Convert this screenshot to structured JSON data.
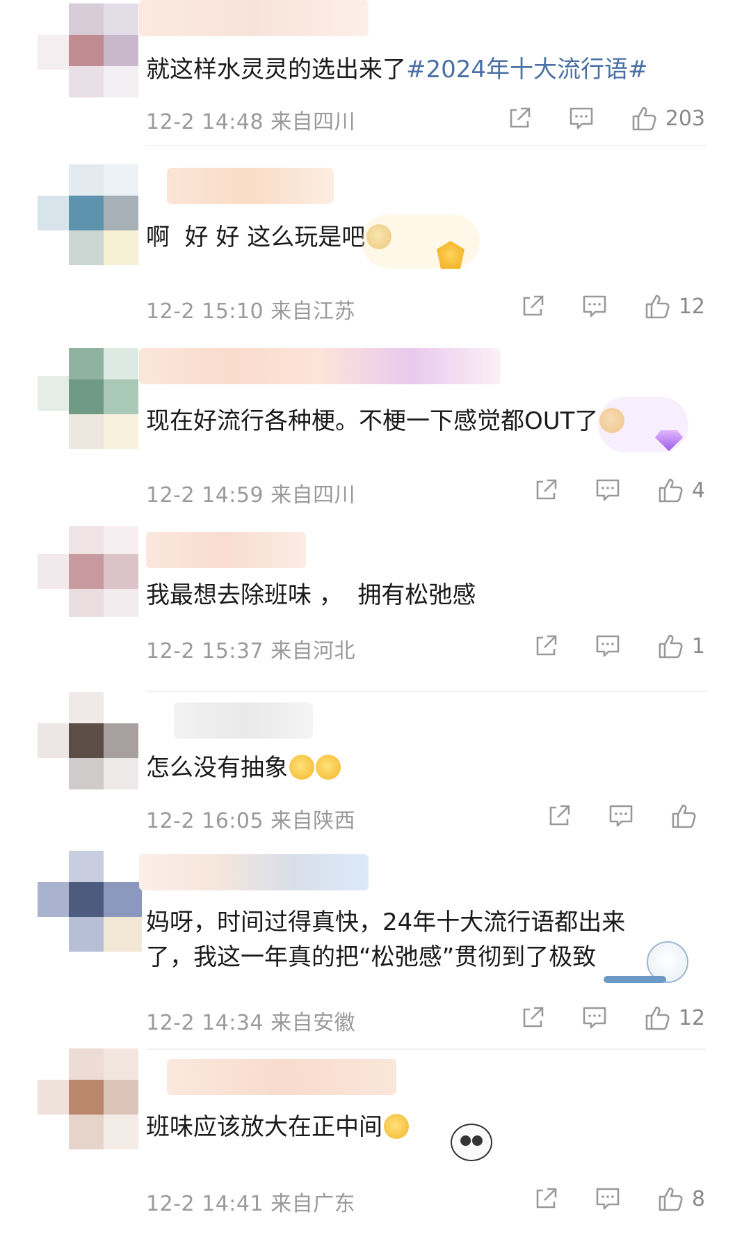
{
  "comments": [
    {
      "text_plain": "就这样水灵灵的选出来了",
      "hashtag": "#2024年十大流行语#",
      "time": "12-2 14:48",
      "location": "来自四川",
      "likes": "203"
    },
    {
      "text": "啊  好 好 这么玩是吧",
      "time": "12-2 15:10",
      "location": "来自江苏",
      "likes": "12"
    },
    {
      "text": "现在好流行各种梗。不梗一下感觉都OUT了",
      "time": "12-2 14:59",
      "location": "来自四川",
      "likes": "4"
    },
    {
      "text": "我最想去除班味 ，  拥有松弛感",
      "time": "12-2 15:37",
      "location": "来自河北",
      "likes": "1"
    },
    {
      "text": "怎么没有抽象",
      "time": "12-2 16:05",
      "location": "来自陕西",
      "likes": ""
    },
    {
      "text": "妈呀，时间过得真快，24年十大流行语都出来\n了，我这一年真的把“松弛感”贯彻到了极致",
      "time": "12-2 14:34",
      "location": "来自安徽",
      "likes": "12"
    },
    {
      "text": "班味应该放大在正中间",
      "time": "12-2 14:41",
      "location": "来自广东",
      "likes": "8"
    }
  ],
  "icons": {
    "share": "share-icon",
    "comment": "comment-icon",
    "like": "thumbs-up-icon"
  },
  "colors": {
    "hashtag": "#4a6fa5",
    "meta": "#9a9a9a",
    "text": "#1a1a1a"
  }
}
